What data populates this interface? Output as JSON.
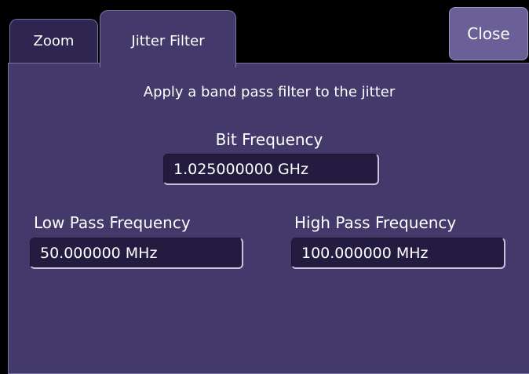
{
  "tabs": [
    {
      "label": "Zoom",
      "active": false
    },
    {
      "label": "Jitter Filter",
      "active": true
    }
  ],
  "close_label": "Close",
  "panel": {
    "description": "Apply a band pass filter to the jitter",
    "bit_frequency": {
      "label": "Bit Frequency",
      "value": "1.025000000 GHz"
    },
    "low_pass": {
      "label": "Low Pass Frequency",
      "value": "50.000000 MHz"
    },
    "high_pass": {
      "label": "High Pass Frequency",
      "value": "100.000000 MHz"
    }
  },
  "colors": {
    "background": "#000000",
    "panel": "#43396a",
    "inactive_tab": "#2e2650",
    "field": "#241c40",
    "close_button": "#6a5f96",
    "text": "#ffffff"
  }
}
